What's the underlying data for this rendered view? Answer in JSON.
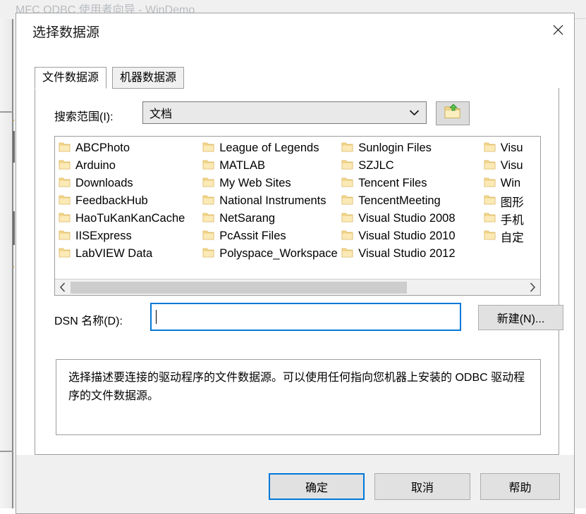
{
  "background_window": {
    "title": "MFC ODBC 使用者向导 - WinDemo"
  },
  "dialog": {
    "title": "选择数据源",
    "close_icon": "close-icon",
    "tabs": [
      {
        "label": "文件数据源",
        "active": true
      },
      {
        "label": "机器数据源",
        "active": false
      }
    ],
    "search_scope": {
      "label": "搜索范围(I):",
      "value": "文档",
      "dropdown_icon": "chevron-down-icon",
      "up_folder_icon": "up-one-level-folder-icon"
    },
    "file_list": {
      "columns": [
        [
          "ABCPhoto",
          "Arduino",
          "Downloads",
          "FeedbackHub",
          "HaoTuKanKanCache",
          "IISExpress",
          "LabVIEW Data"
        ],
        [
          "League of Legends",
          "MATLAB",
          "My Web Sites",
          "National Instruments",
          "NetSarang",
          "PcAssit Files",
          "Polyspace_Workspace"
        ],
        [
          "Sunlogin Files",
          "SZJLC",
          "Tencent Files",
          "TencentMeeting",
          "Visual Studio 2008",
          "Visual Studio 2010",
          "Visual Studio 2012"
        ],
        [
          "Visu",
          "Visu",
          "Win",
          "图形",
          "手机",
          "自定"
        ]
      ],
      "folder_icon": "folder-icon",
      "scroll_left_icon": "chevron-left-icon",
      "scroll_right_icon": "chevron-right-icon",
      "scroll_thumb_percent": 74
    },
    "dsn": {
      "label": "DSN 名称(D):",
      "value": "",
      "new_button_label": "新建(N)..."
    },
    "description": "选择描述要连接的驱动程序的文件数据源。可以使用任何指向您机器上安装的 ODBC 驱动程序的文件数据源。",
    "footer": {
      "ok_label": "确定",
      "cancel_label": "取消",
      "help_label": "帮助"
    }
  },
  "colors": {
    "accent": "#0078d7",
    "dialog_bg": "#f0f0f0",
    "button_face": "#e1e1e1",
    "folder_yellow": "#f7da8a",
    "disabled_title": "#b9bcc0"
  }
}
